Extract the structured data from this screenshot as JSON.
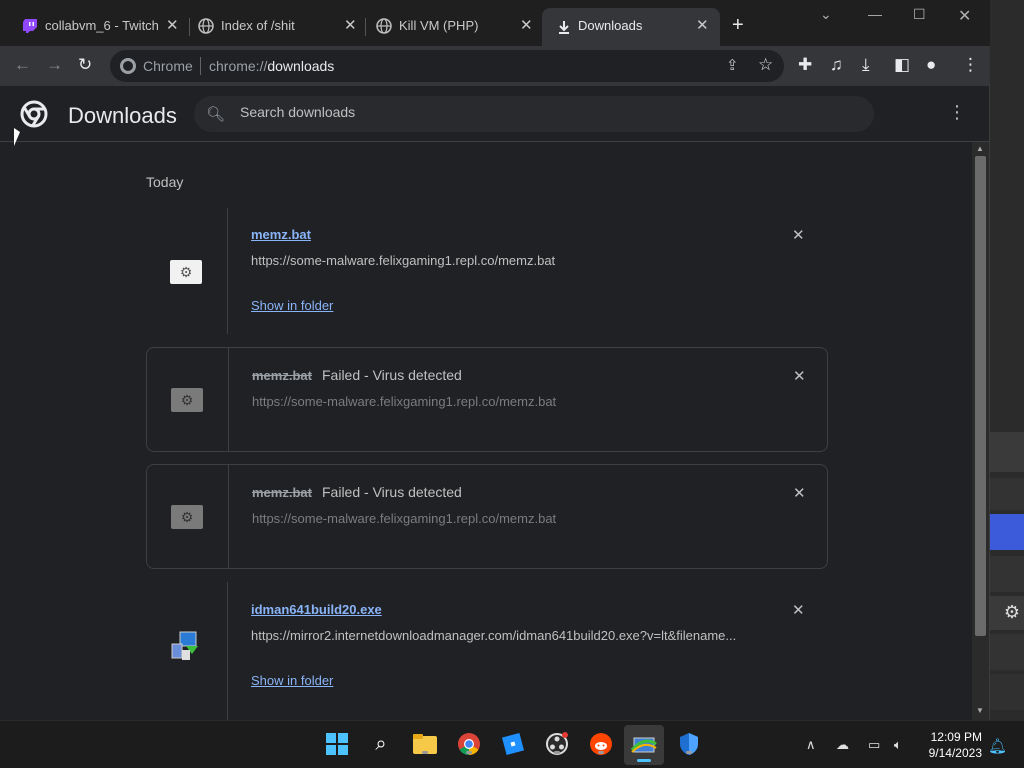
{
  "tabs": [
    {
      "title": "collabvm_6 - Twitch",
      "favicon": "twitch-icon"
    },
    {
      "title": "Index of /shit",
      "favicon": "globe-icon"
    },
    {
      "title": "Kill VM (PHP)",
      "favicon": "globe-icon"
    },
    {
      "title": "Downloads",
      "favicon": "download-icon",
      "active": true
    }
  ],
  "omnibox": {
    "site_chip": "Chrome",
    "url_prefix": "chrome://",
    "url_path": "downloads"
  },
  "page": {
    "title": "Downloads",
    "search_placeholder": "Search downloads",
    "day_label": "Today"
  },
  "downloads": [
    {
      "filename": "memz.bat",
      "status": "",
      "url": "https://some-malware.felixgaming1.repl.co/memz.bat",
      "action": "Show in folder",
      "icon": "gear-file-icon"
    },
    {
      "filename": "memz.bat",
      "status": "Failed - Virus detected",
      "url": "https://some-malware.felixgaming1.repl.co/memz.bat",
      "icon": "gear-file-icon"
    },
    {
      "filename": "memz.bat",
      "status": "Failed - Virus detected",
      "url": "https://some-malware.felixgaming1.repl.co/memz.bat",
      "icon": "gear-file-icon"
    },
    {
      "filename": "idman641build20.exe",
      "status": "",
      "url": "https://mirror2.internetdownloadmanager.com/idman641build20.exe?v=lt&filename...",
      "action": "Show in folder",
      "icon": "installer-icon"
    }
  ],
  "taskbar": {
    "apps": [
      "windows-start-icon",
      "search-icon",
      "file-explorer-icon",
      "chrome-icon",
      "roblox-icon",
      "obs-icon",
      "reddit-icon",
      "control-panel-icon",
      "defender-icon"
    ],
    "time": "12:09 PM",
    "date": "9/14/2023"
  },
  "colors": {
    "accent_link": "#8ab4f8",
    "background": "#202124",
    "toolbar": "#35363a"
  }
}
